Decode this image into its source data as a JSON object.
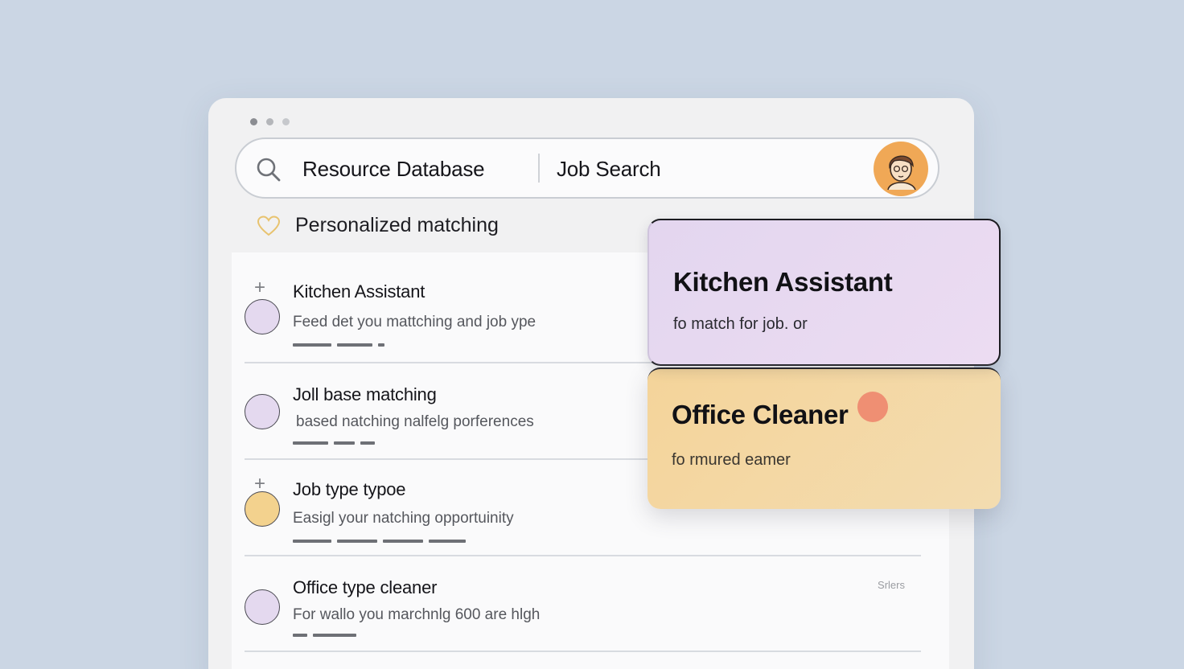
{
  "colors": {
    "background": "#cbd6e4",
    "card_kitchen": "#e6d8f0",
    "card_office": "#f4d6a0",
    "circle_lavender": "#e4d9ef",
    "circle_yellow": "#f3d28e",
    "accent_dot": "#ef8f73",
    "avatar": "#f0a856"
  },
  "search": {
    "tab_resource": "Resource Database",
    "tab_job": "Job Search",
    "search_icon": "search-icon",
    "avatar_icon": "user-avatar"
  },
  "section": {
    "icon": "heart-icon",
    "title": "Personalized matching"
  },
  "rows": [
    {
      "title": "Kitchen Assistant",
      "desc": "Feed det you mattching and job ype",
      "has_plus": true,
      "circle": "lavender",
      "bars": [
        48,
        44,
        8
      ],
      "tag": ""
    },
    {
      "title": "Joll base matching",
      "desc": "based natching nalfelg porferences",
      "has_plus": false,
      "circle": "lavender",
      "bars": [
        44,
        26,
        18
      ],
      "tag": ""
    },
    {
      "title": "Job type typoe",
      "desc": "Easigl your natching opportuinity",
      "has_plus": true,
      "circle": "yellow",
      "bars": [
        48,
        50,
        50,
        46
      ],
      "tag": ""
    },
    {
      "title": "Office type cleaner",
      "desc": "For wallo you marchnlg 600 are hlgh",
      "has_plus": false,
      "circle": "lavender",
      "bars": [
        18,
        54
      ],
      "tag": "Srlers"
    }
  ],
  "cards": {
    "kitchen": {
      "title": "Kitchen Assistant",
      "subtitle": "fo match for job. or"
    },
    "office": {
      "title": "Office Cleaner",
      "subtitle": "fo rmured eamer"
    }
  }
}
